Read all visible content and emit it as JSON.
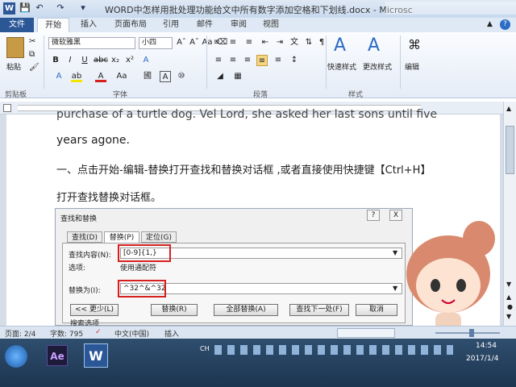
{
  "window": {
    "title": "WORD中怎样用批处理功能给文中所有数字添加空格和下划线.docx - Microsc"
  },
  "ribbon_tabs": [
    "文件",
    "开始",
    "插入",
    "页面布局",
    "引用",
    "邮件",
    "审阅",
    "视图"
  ],
  "ribbon": {
    "paste_label": "粘贴",
    "clipboard_label": "剪贴板",
    "font_name": "微软雅黑",
    "font_size": "小四",
    "font_group_label": "字体",
    "paragraph_group_label": "段落",
    "styles_group_label": "样式",
    "quick_styles_label": "快速样式",
    "change_styles_label": "更改样式",
    "edit_label": "编辑"
  },
  "document": {
    "line_partial": "purchase of a turtle dog. Vel Lord, she asked her last sons until five",
    "line1": "years agone.",
    "line2": "一、点击开始-编辑-替换打开查找和替换对话框 ,或者直接使用快捷键【Ctrl+H】",
    "line3": "打开查找替换对话框。"
  },
  "dialog": {
    "title": "查找和替换",
    "tabs": [
      "查找(D)",
      "替换(P)",
      "定位(G)"
    ],
    "find_label": "查找内容(N):",
    "find_value": "[0-9]{1,}",
    "options_label": "选项:",
    "options_value": "使用通配符",
    "replace_label": "替换为(I):",
    "replace_value": "^32^&^32",
    "buttons": [
      "<< 更少(L)",
      "替换(R)",
      "全部替换(A)",
      "查找下一处(F)",
      "取消"
    ],
    "search_options": "搜索选项",
    "help": "?",
    "close": "X"
  },
  "statusbar": {
    "page": "页面: 2/4",
    "words": "字数: 795",
    "language": "中文(中国)",
    "mode": "插入"
  },
  "taskbar": {
    "ime": "CH",
    "time": "14:54",
    "date": "2017/1/4",
    "app_ae": "Ae",
    "app_word": "W"
  },
  "colors": {
    "accent": "#2b5797",
    "highlight": "#d62020"
  }
}
